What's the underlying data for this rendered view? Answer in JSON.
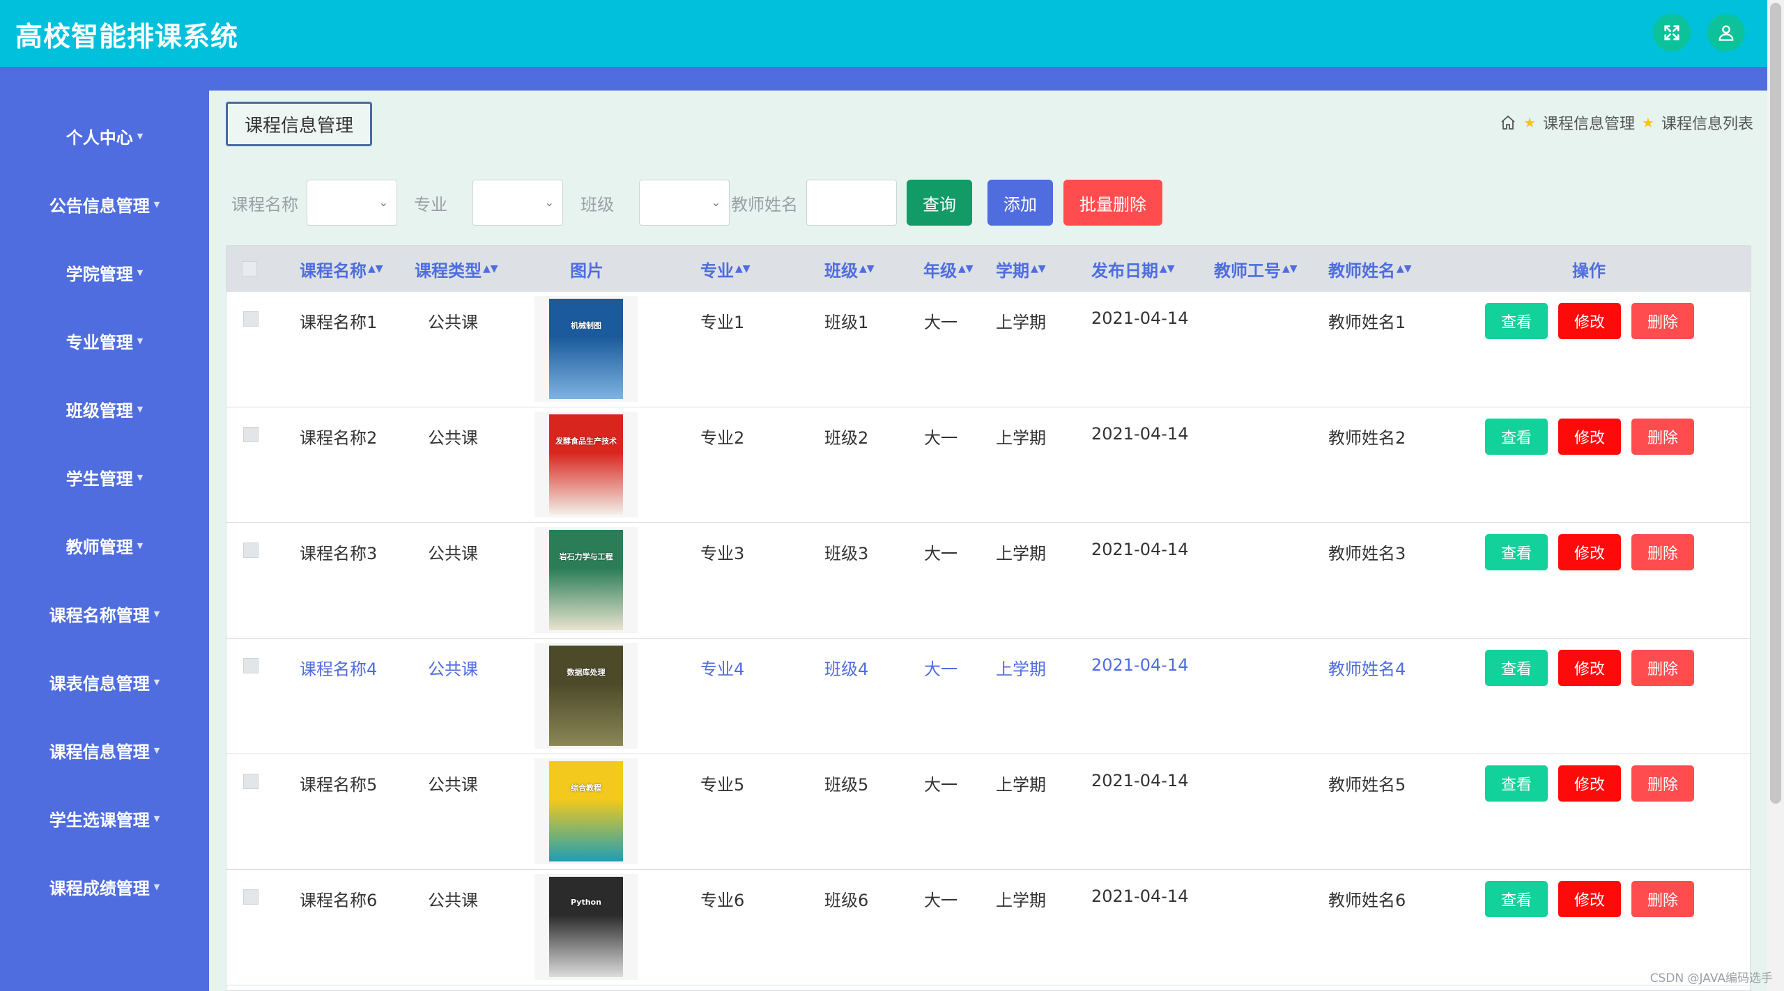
{
  "app": {
    "title": "高校智能排课系统"
  },
  "sidebar": {
    "items": [
      {
        "label": "个人中心"
      },
      {
        "label": "公告信息管理"
      },
      {
        "label": "学院管理"
      },
      {
        "label": "专业管理"
      },
      {
        "label": "班级管理"
      },
      {
        "label": "学生管理"
      },
      {
        "label": "教师管理"
      },
      {
        "label": "课程名称管理"
      },
      {
        "label": "课表信息管理"
      },
      {
        "label": "课程信息管理"
      },
      {
        "label": "学生选课管理"
      },
      {
        "label": "课程成绩管理"
      }
    ]
  },
  "page": {
    "tab": "课程信息管理"
  },
  "breadcrumb": {
    "items": [
      "课程信息管理",
      "课程信息列表"
    ]
  },
  "filters": {
    "course_name_label": "课程名称",
    "major_label": "专业",
    "class_label": "班级",
    "teacher_name_label": "教师姓名",
    "query_button": "查询",
    "add_button": "添加",
    "batch_delete_button": "批量删除"
  },
  "table": {
    "columns": [
      "课程名称",
      "课程类型",
      "图片",
      "专业",
      "班级",
      "年级",
      "学期",
      "发布日期",
      "教师工号",
      "教师姓名",
      "操作"
    ],
    "actions": {
      "view": "查看",
      "edit": "修改",
      "delete": "删除"
    },
    "rows": [
      {
        "name": "课程名称1",
        "type": "公共课",
        "major": "专业1",
        "class": "班级1",
        "grade": "大一",
        "term": "上学期",
        "date": "2021-04-14",
        "teacher_no": "",
        "teacher": "教师姓名1",
        "cover": {
          "top": "#1b5a9c",
          "bottom": "#7fb3e0",
          "title": "机械制图"
        }
      },
      {
        "name": "课程名称2",
        "type": "公共课",
        "major": "专业2",
        "class": "班级2",
        "grade": "大一",
        "term": "上学期",
        "date": "2021-04-14",
        "teacher_no": "",
        "teacher": "教师姓名2",
        "cover": {
          "top": "#d8261f",
          "bottom": "#f3efe8",
          "title": "发酵食品生产技术"
        }
      },
      {
        "name": "课程名称3",
        "type": "公共课",
        "major": "专业3",
        "class": "班级3",
        "grade": "大一",
        "term": "上学期",
        "date": "2021-04-14",
        "teacher_no": "",
        "teacher": "教师姓名3",
        "cover": {
          "top": "#2a7d57",
          "bottom": "#e9e3d0",
          "title": "岩石力学与工程"
        }
      },
      {
        "name": "课程名称4",
        "type": "公共课",
        "major": "专业4",
        "class": "班级4",
        "grade": "大一",
        "term": "上学期",
        "date": "2021-04-14",
        "teacher_no": "",
        "teacher": "教师姓名4",
        "cover": {
          "top": "#4d4a2a",
          "bottom": "#8b8756",
          "title": "数据库处理"
        }
      },
      {
        "name": "课程名称5",
        "type": "公共课",
        "major": "专业5",
        "class": "班级5",
        "grade": "大一",
        "term": "上学期",
        "date": "2021-04-14",
        "teacher_no": "",
        "teacher": "教师姓名5",
        "cover": {
          "top": "#f2c91c",
          "bottom": "#1d9fb6",
          "title": "综合教程"
        }
      },
      {
        "name": "课程名称6",
        "type": "公共课",
        "major": "专业6",
        "class": "班级6",
        "grade": "大一",
        "term": "上学期",
        "date": "2021-04-14",
        "teacher_no": "",
        "teacher": "教师姓名6",
        "cover": {
          "top": "#2b2b2b",
          "bottom": "#dcdcdc",
          "title": "Python"
        }
      }
    ]
  },
  "watermark": "CSDN @JAVA编码选手",
  "colors": {
    "topbar": "#00c0dc",
    "sidebar": "#4f6ddf",
    "query": "#129a67",
    "add": "#4f6ddf",
    "batch_delete": "#ff4d4f",
    "view": "#12d19a",
    "edit": "#ff0a0a",
    "delete": "#ff4d4f"
  }
}
